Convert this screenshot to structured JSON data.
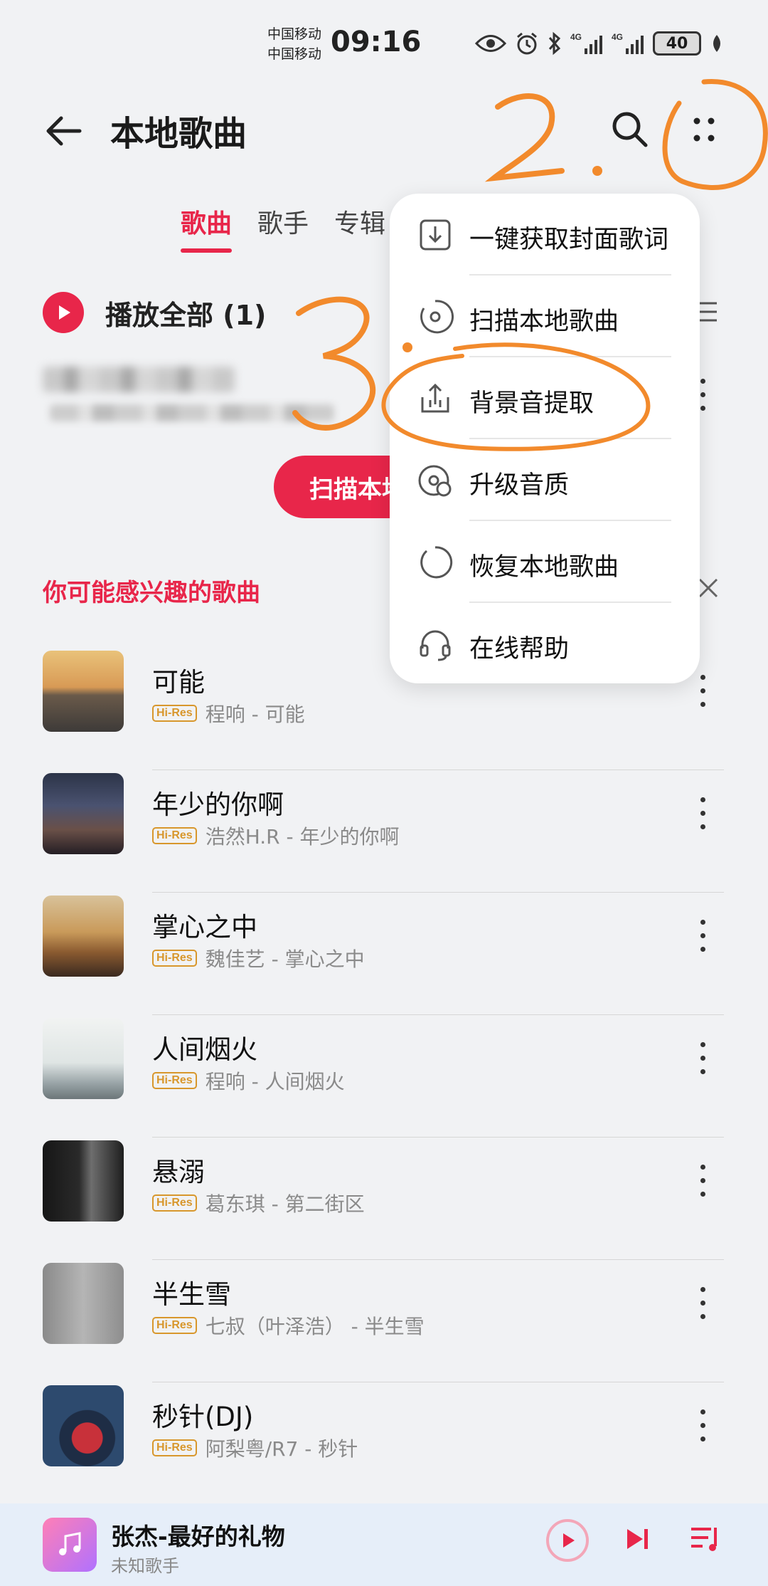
{
  "status_bar": {
    "carrier_1": "中国移动",
    "carrier_2": "中国移动",
    "time": "09:16",
    "battery": "40",
    "icons": [
      "eye-icon",
      "alarm-icon",
      "bluetooth-icon",
      "signal-4g-icon",
      "signal-4g-icon",
      "leaf-icon"
    ]
  },
  "header": {
    "title": "本地歌曲",
    "back_icon": "arrow-left-icon",
    "search_icon": "search-icon",
    "more_icon": "more-dots-icon"
  },
  "tabs": [
    {
      "label": "歌曲",
      "active": true
    },
    {
      "label": "歌手",
      "active": false
    },
    {
      "label": "专辑",
      "active": false
    }
  ],
  "play_all": {
    "label": "播放全部 (1)"
  },
  "scan_button": {
    "label": "扫描本地"
  },
  "recommend": {
    "title": "你可能感兴趣的歌曲",
    "songs": [
      {
        "title": "可能",
        "badge": "Hi-Res",
        "subtitle": "程响 - 可能"
      },
      {
        "title": "年少的你啊",
        "badge": "Hi-Res",
        "subtitle": "浩然H.R - 年少的你啊"
      },
      {
        "title": "掌心之中",
        "badge": "Hi-Res",
        "subtitle": "魏佳艺 - 掌心之中"
      },
      {
        "title": "人间烟火",
        "badge": "Hi-Res",
        "subtitle": "程响 - 人间烟火"
      },
      {
        "title": "悬溺",
        "badge": "Hi-Res",
        "subtitle": "葛东琪 - 第二街区"
      },
      {
        "title": "半生雪",
        "badge": "Hi-Res",
        "subtitle": "七叔（叶泽浩） - 半生雪"
      },
      {
        "title": "秒针(DJ)",
        "badge": "Hi-Res",
        "subtitle": "阿梨粤/R7 - 秒针"
      }
    ]
  },
  "menu": {
    "items": [
      {
        "label": "一键获取封面歌词",
        "icon": "download-icon"
      },
      {
        "label": "扫描本地歌曲",
        "icon": "scan-disc-icon"
      },
      {
        "label": "背景音提取",
        "icon": "upload-icon"
      },
      {
        "label": "升级音质",
        "icon": "disc-upgrade-icon"
      },
      {
        "label": "恢复本地歌曲",
        "icon": "restore-icon"
      },
      {
        "label": "在线帮助",
        "icon": "headset-icon"
      }
    ]
  },
  "player": {
    "title": "张杰-最好的礼物",
    "artist": "未知歌手"
  },
  "annotations": {
    "step2": "2.",
    "step3": "3."
  },
  "colors": {
    "accent": "#e8264a",
    "annotation": "#f28a2c",
    "hires": "#d8972c"
  }
}
